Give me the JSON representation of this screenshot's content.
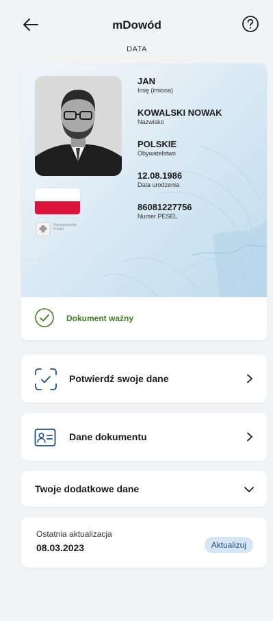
{
  "header": {
    "title": "mDowód",
    "subtitle": "DATA"
  },
  "card": {
    "fields": [
      {
        "value": "JAN",
        "label": "Imię (imiona)"
      },
      {
        "value": "KOWALSKI NOWAK",
        "label": "Nazwisko"
      },
      {
        "value": "POLSKIE",
        "label": "Obywatelstwo"
      },
      {
        "value": "12.08.1986",
        "label": "Data urodzenia"
      },
      {
        "value": "86081227756",
        "label": "Numer PESEL"
      }
    ],
    "emblem_text": "Rzeczpospolita Polska",
    "status": "Dokument ważny",
    "status_color": "#3f7d1e",
    "flag_colors": [
      "#ffffff",
      "#dc143c"
    ]
  },
  "actions": {
    "confirm_label": "Potwierdź swoje dane",
    "details_label": "Dane dokumentu",
    "extra_label": "Twoje dodatkowe dane"
  },
  "update": {
    "label": "Ostatnia aktualizacja",
    "date": "08.03.2023",
    "button": "Aktualizuj"
  },
  "colors": {
    "accent": "#1f4e84",
    "background": "#f2f3f5"
  }
}
